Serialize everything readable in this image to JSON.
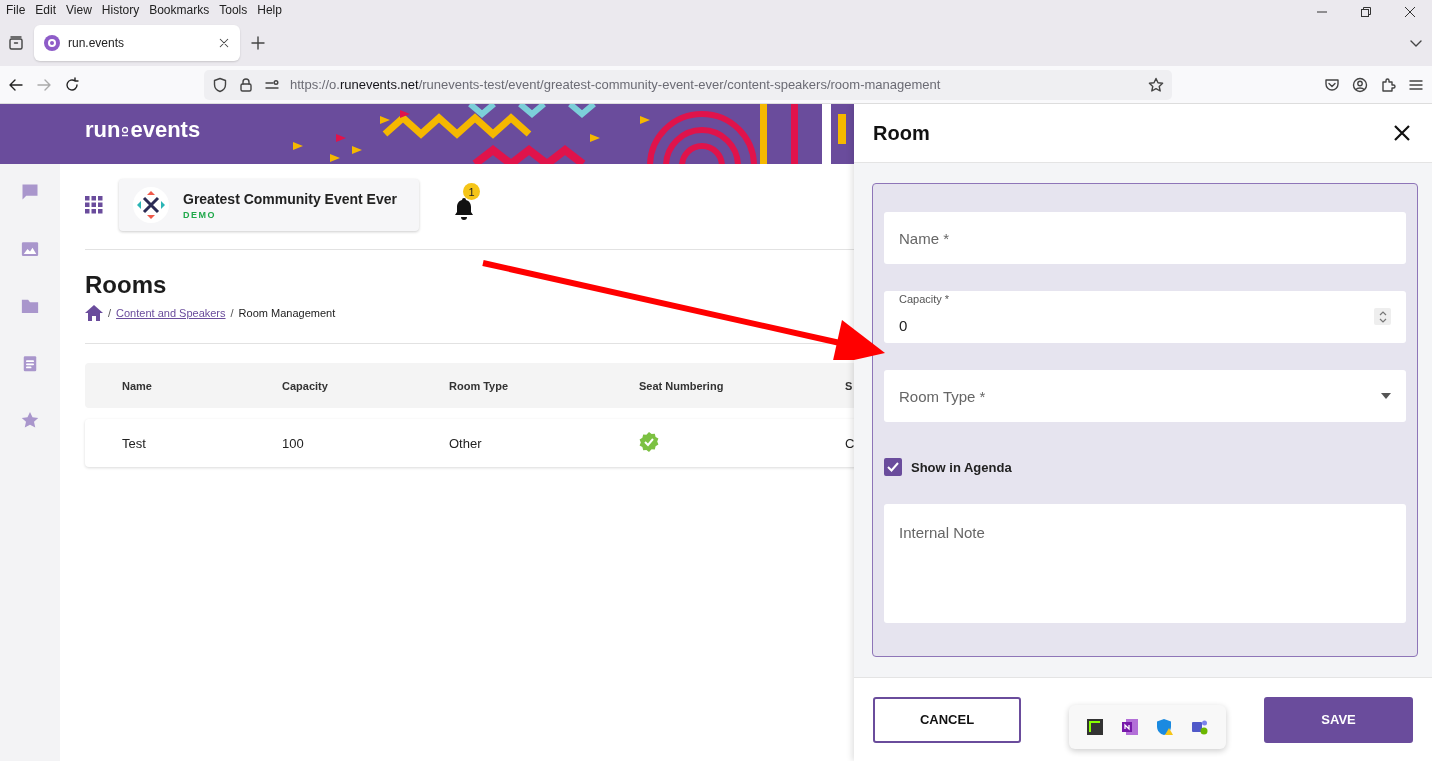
{
  "browser": {
    "menu": [
      "File",
      "Edit",
      "View",
      "History",
      "Bookmarks",
      "Tools",
      "Help"
    ],
    "tab": {
      "title": "run.events"
    },
    "url": {
      "prefix": "https://o.",
      "host": "runevents.net",
      "path": "/runevents-test/event/greatest-community-event-ever/content-speakers/room-management"
    }
  },
  "banner": {
    "logo_left": "run",
    "logo_right": "events"
  },
  "event": {
    "name": "Greatest Community Event Ever",
    "badge": "DEMO",
    "notifications": "1"
  },
  "page": {
    "title": "Rooms",
    "breadcrumb": [
      {
        "separator": "/",
        "label": "Content and Speakers",
        "link": true
      },
      {
        "separator": "/",
        "label": "Room Management",
        "link": false
      }
    ]
  },
  "table": {
    "columns": [
      "Name",
      "Capacity",
      "Room Type",
      "Seat Numbering",
      "S"
    ],
    "rows": [
      {
        "name": "Test",
        "capacity": "100",
        "room_type": "Other",
        "seat_numbering": true,
        "column_5": "C"
      }
    ]
  },
  "drawer": {
    "title": "Room",
    "fields": [
      {
        "kind": "text",
        "placeholder": "Name *"
      },
      {
        "kind": "number",
        "label": "Capacity *",
        "value": "0"
      },
      {
        "kind": "select",
        "label": "Room Type *"
      },
      {
        "kind": "checkbox",
        "label": "Show in Agenda",
        "checked": true
      },
      {
        "kind": "textarea",
        "placeholder": "Internal Note"
      }
    ],
    "buttons": [
      {
        "kind": "outline",
        "label": "CANCEL"
      },
      {
        "kind": "primary",
        "label": "SAVE"
      }
    ]
  }
}
